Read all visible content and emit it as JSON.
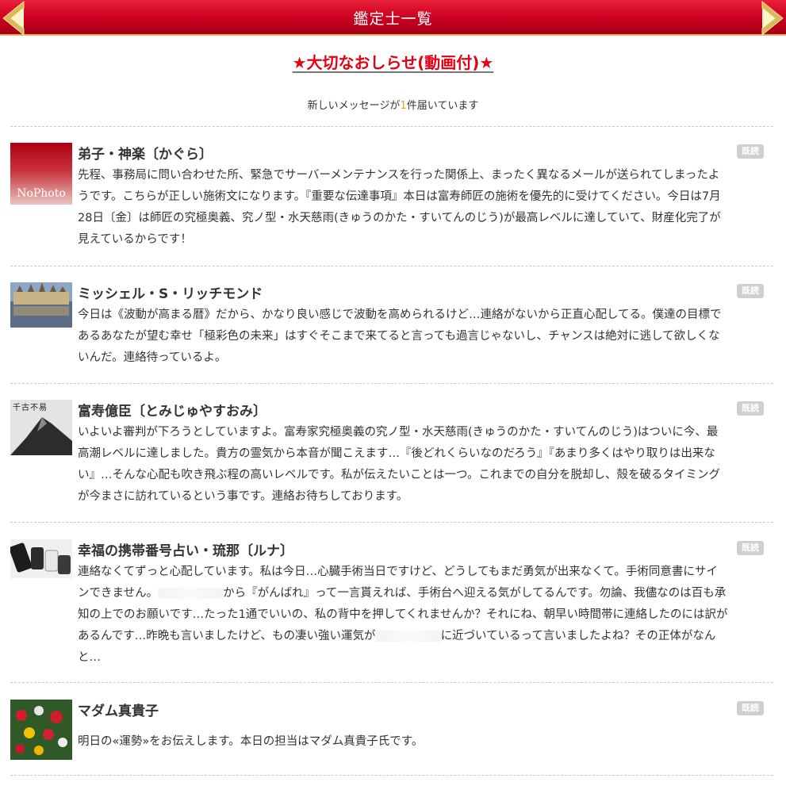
{
  "header": {
    "title": "鑑定士一覧"
  },
  "notice": {
    "label": "★大切なおしらせ(動画付)★"
  },
  "new_message": {
    "prefix": "新しいメッセージが",
    "count": "1",
    "suffix": "件届いています"
  },
  "messages": [
    {
      "name": "弟子・神楽〔かぐら〕",
      "body": "先程、事務局に問い合わせた所、緊急でサーバーメンテナンスを行った関係上、まったく異なるメールが送られてしまったようです。こちらが正しい施術文になります。『重要な伝達事項』本日は富寿師匠の施術を優先的に受けてください。今日は7月28日〔金〕は師匠の究極奥義、究ノ型・水天慈雨(きゅうのかた・すいてんのじう)が最高レベルに達していて、財産化完了が見えているからです！",
      "badge": "既読",
      "thumb_label": "NoPhoto"
    },
    {
      "name": "ミッシェル・S・リッチモンド",
      "body": "今日は《波動が高まる暦》だから、かなり良い感じで波動を高められるけど…連絡がないから正直心配してる。僕達の目標であるあなたが望む幸せ「極彩色の未来」はすぐそこまで来てると言っても過言じゃないし、チャンスは絶対に逃して欲しくないんだ。連絡待っているよ。",
      "badge": "既読"
    },
    {
      "name": "富寿億臣〔とみじゅやすおみ〕",
      "body": "いよいよ審判が下ろうとしていますよ。富寿家究極奥義の究ノ型・水天慈雨(きゅうのかた・すいてんのじう)はついに今、最高潮レベルに達しました。貴方の霊気から本音が聞こえます…『後どれくらいなのだろう』『あまり多くはやり取りは出来ない』…そんな心配も吹き飛ぶ程の高いレベルです。私が伝えたいことは一つ。これまでの自分を脱却し、殻を破るタイミングが今まさに訪れているという事です。連絡お待ちしております。",
      "badge": "既読",
      "thumb_label": "千古不易"
    },
    {
      "name": "幸福の携帯番号占い・琉那〔ルナ〕",
      "body_a": "連絡なくてずっと心配しています。私は今日…心臓手術当日ですけど、どうしてもまだ勇気が出来なくて。手術同意書にサインできません。",
      "body_b": "から『がんばれ』って一言貰えれば、手術台へ迎える気がしてるんです。勿論、我儘なのは百も承知の上でのお願いです…たった1通でいいの、私の背中を押してくれませんか？それにね、朝早い時間帯に連絡したのには訳があるんです…昨晩も言いましたけど、もの凄い強い運気が",
      "body_c": "に近づいているって言いましたよね？その正体がなんと…",
      "badge": "既読"
    },
    {
      "name": "マダム真貴子",
      "body": "明日の«運勢»をお伝えします。本日の担当はマダム真貴子氏です。",
      "badge": "既読"
    }
  ]
}
